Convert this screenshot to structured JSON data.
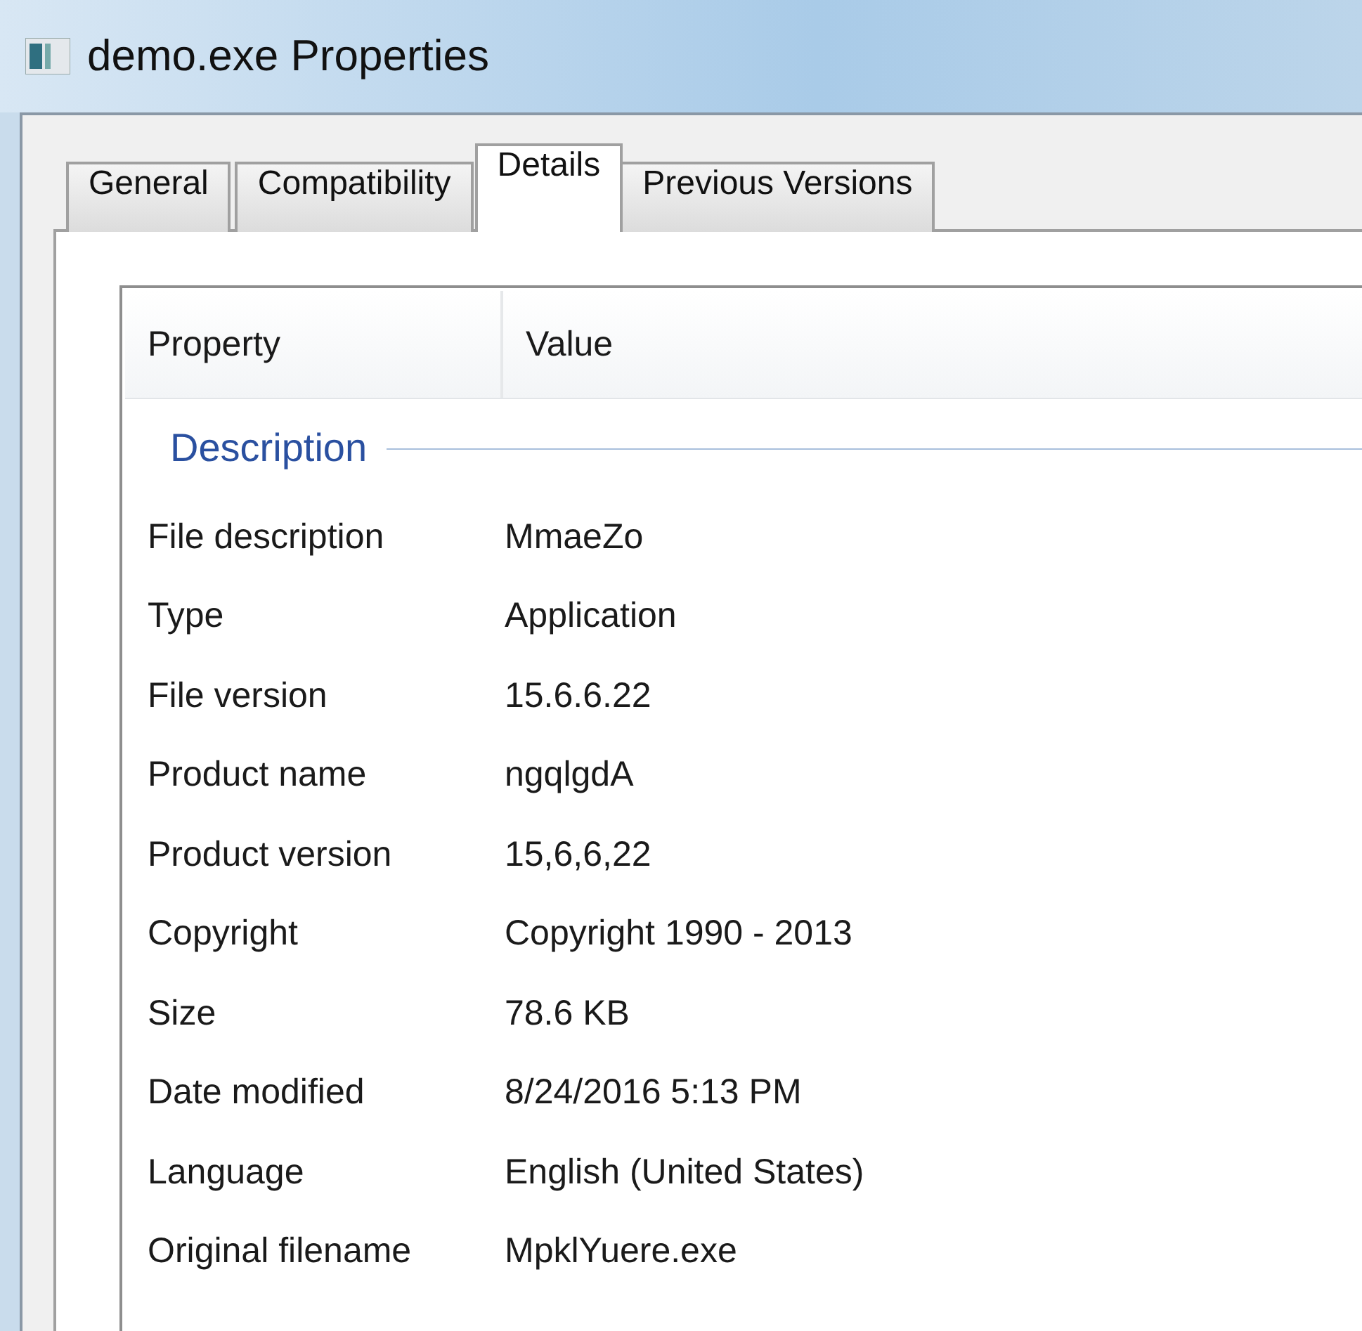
{
  "window": {
    "title": "demo.exe Properties"
  },
  "tabs": [
    {
      "label": "General",
      "selected": false
    },
    {
      "label": "Compatibility",
      "selected": false
    },
    {
      "label": "Details",
      "selected": true
    },
    {
      "label": "Previous Versions",
      "selected": false
    }
  ],
  "details": {
    "columns": [
      "Property",
      "Value"
    ],
    "group": "Description",
    "rows": [
      {
        "property": "File description",
        "value": "MmaeZo"
      },
      {
        "property": "Type",
        "value": "Application"
      },
      {
        "property": "File version",
        "value": "15.6.6.22"
      },
      {
        "property": "Product name",
        "value": "ngqlgdA"
      },
      {
        "property": "Product version",
        "value": "15,6,6,22"
      },
      {
        "property": "Copyright",
        "value": "Copyright 1990 - 2013"
      },
      {
        "property": "Size",
        "value": "78.6 KB"
      },
      {
        "property": "Date modified",
        "value": "8/24/2016 5:13 PM"
      },
      {
        "property": "Language",
        "value": "English (United States)"
      },
      {
        "property": "Original filename",
        "value": "MpklYuere.exe"
      }
    ]
  }
}
